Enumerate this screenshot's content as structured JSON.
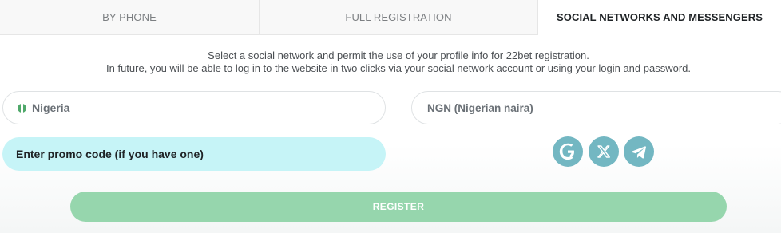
{
  "tabs": [
    {
      "label": "BY PHONE"
    },
    {
      "label": "FULL REGISTRATION"
    },
    {
      "label": "SOCIAL NETWORKS AND MESSENGERS"
    }
  ],
  "description": {
    "line1": "Select a social network and permit the use of your profile info for 22bet registration.",
    "line2": "In future, you will be able to log in to the website in two clicks via your social network account or using your login and password."
  },
  "country": {
    "value": "Nigeria",
    "flag_icon": "nigeria-flag-icon",
    "flag_colors": [
      "#4fa86a",
      "#ffffff",
      "#4fa86a"
    ]
  },
  "currency": {
    "value": "NGN (Nigerian naira)"
  },
  "promo": {
    "placeholder": "Enter promo code (if you have one)"
  },
  "social_buttons": [
    {
      "icon": "google-icon"
    },
    {
      "icon": "x-icon"
    },
    {
      "icon": "telegram-icon"
    }
  ],
  "register": {
    "label": "REGISTER"
  },
  "colors": {
    "accent_green": "#96d6ad",
    "promo_bg": "#c6f4f7",
    "social_bg": "#73b7c2",
    "text_dark": "#1f2326",
    "text_muted": "#7c7f82"
  }
}
